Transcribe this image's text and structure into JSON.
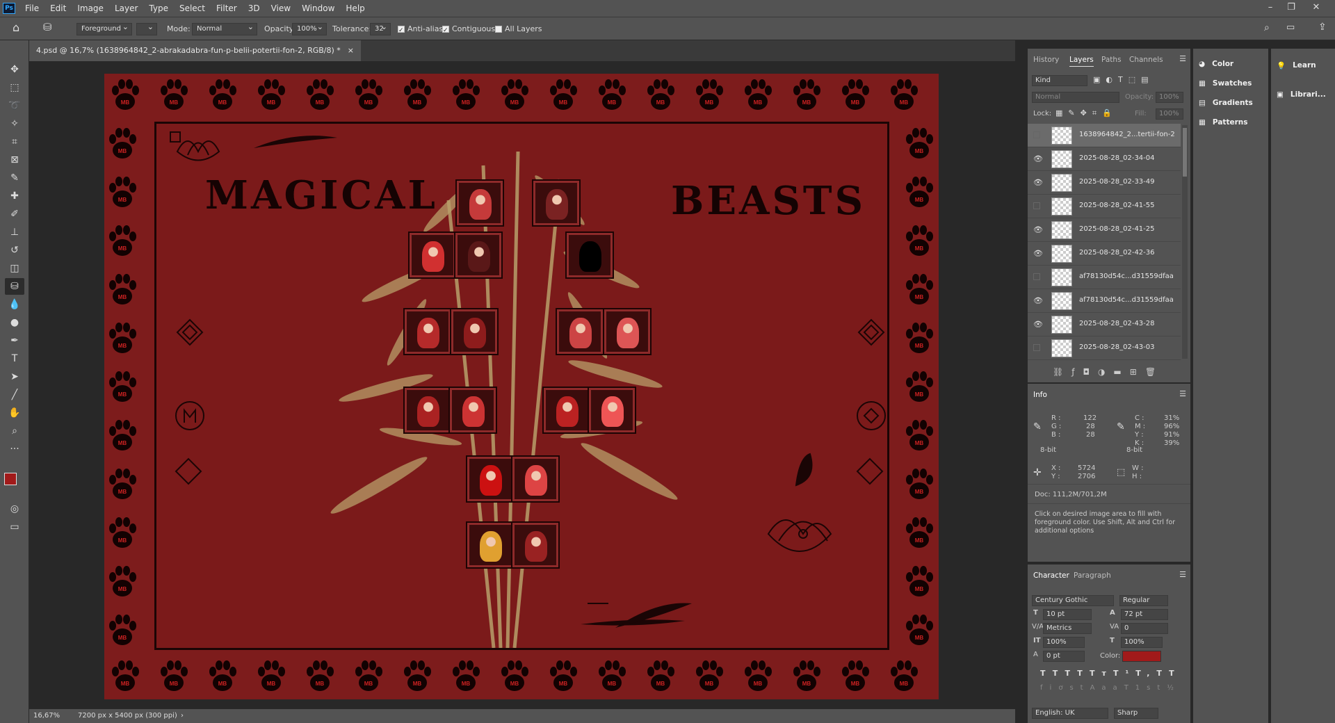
{
  "menubar": {
    "logo": "Ps",
    "items": [
      "File",
      "Edit",
      "Image",
      "Layer",
      "Type",
      "Select",
      "Filter",
      "3D",
      "View",
      "Window",
      "Help"
    ]
  },
  "options": {
    "fill_source": "Foreground",
    "mode_label": "Mode:",
    "mode_value": "Normal",
    "opacity_label": "Opacity:",
    "opacity_value": "100%",
    "tolerance_label": "Tolerance:",
    "tolerance_value": "32",
    "anti_alias": "Anti-alias",
    "contiguous": "Contiguous",
    "all_layers": "All Layers"
  },
  "document": {
    "tab_title": "4.psd @ 16,7% (1638964842_2-abrakadabra-fun-p-belii-potertii-fon-2, RGB/8) *",
    "close": "×",
    "art_title_left": "MAGICAL",
    "art_title_right": "BEASTS"
  },
  "status": {
    "zoom": "16,67%",
    "doc_size": "7200 px x 5400 px (300 ppi)",
    "arrow": "›"
  },
  "layers_panel": {
    "tabs": [
      "History",
      "Layers",
      "Paths",
      "Channels"
    ],
    "filter_kind": "Kind",
    "blend": "Normal",
    "opacity_label": "Opacity:",
    "opacity_value": "100%",
    "lock_label": "Lock:",
    "fill_label": "Fill:",
    "fill_value": "100%",
    "layers": [
      {
        "name": "1638964842_2...tertii-fon-2",
        "visible": false,
        "selected": true
      },
      {
        "name": "2025-08-28_02-34-04",
        "visible": true,
        "selected": false
      },
      {
        "name": "2025-08-28_02-33-49",
        "visible": true,
        "selected": false
      },
      {
        "name": "2025-08-28_02-41-55",
        "visible": false,
        "selected": false
      },
      {
        "name": "2025-08-28_02-41-25",
        "visible": true,
        "selected": false
      },
      {
        "name": "2025-08-28_02-42-36",
        "visible": true,
        "selected": false
      },
      {
        "name": "af78130d54c...d31559dfaa",
        "visible": false,
        "selected": false
      },
      {
        "name": "af78130d54c...d31559dfaa",
        "visible": true,
        "selected": false
      },
      {
        "name": "2025-08-28_02-43-28",
        "visible": true,
        "selected": false
      },
      {
        "name": "2025-08-28_02-43-03",
        "visible": false,
        "selected": false
      }
    ]
  },
  "info_panel": {
    "title": "Info",
    "r_label": "R :",
    "r": "122",
    "g_label": "G :",
    "g": "28",
    "b_label": "B :",
    "b": "28",
    "c_label": "C :",
    "c": "31%",
    "m_label": "M :",
    "m": "96%",
    "y_label": "Y :",
    "y": "91%",
    "k_label": "K :",
    "k": "39%",
    "bit_left": "8-bit",
    "bit_right": "8-bit",
    "x_label": "X :",
    "x": "5724",
    "y2_label": "Y :",
    "y2": "2706",
    "w_label": "W :",
    "h_label": "H :",
    "doc": "Doc: 111,2M/701,2M",
    "hint": "Click on desired image area to fill with foreground color. Use Shift, Alt and Ctrl for additional options"
  },
  "character_panel": {
    "tabs": [
      "Character",
      "Paragraph"
    ],
    "font_family": "Century Gothic",
    "font_style": "Regular",
    "size": "10 pt",
    "leading": "72 pt",
    "kerning": "Metrics",
    "tracking": "0",
    "vscale": "100%",
    "hscale": "100%",
    "baseline": "0 pt",
    "color_label": "Color:",
    "color": "#a11a1a",
    "language": "English: UK",
    "antialias": "Sharp",
    "style_buttons": [
      "T",
      "T",
      "TT",
      "Tт",
      "T¹",
      "T,",
      "T",
      "T"
    ],
    "opentype_buttons": [
      "fi",
      "ơ",
      "st",
      "A",
      "aa",
      "T",
      "1st",
      "½"
    ]
  },
  "side_panel": {
    "items": [
      "Color",
      "Swatches",
      "Gradients",
      "Patterns"
    ]
  },
  "learn_panel": {
    "items": [
      "Learn",
      "Librari..."
    ]
  },
  "colors": {
    "foreground": "#a11a1a",
    "background": "#1a6b1a",
    "art_bg": "#7d1c1c"
  },
  "portraits": [
    "",
    "",
    "",
    "",
    "",
    "",
    "",
    "",
    "",
    "",
    "",
    "",
    "",
    "",
    "",
    "",
    ""
  ]
}
